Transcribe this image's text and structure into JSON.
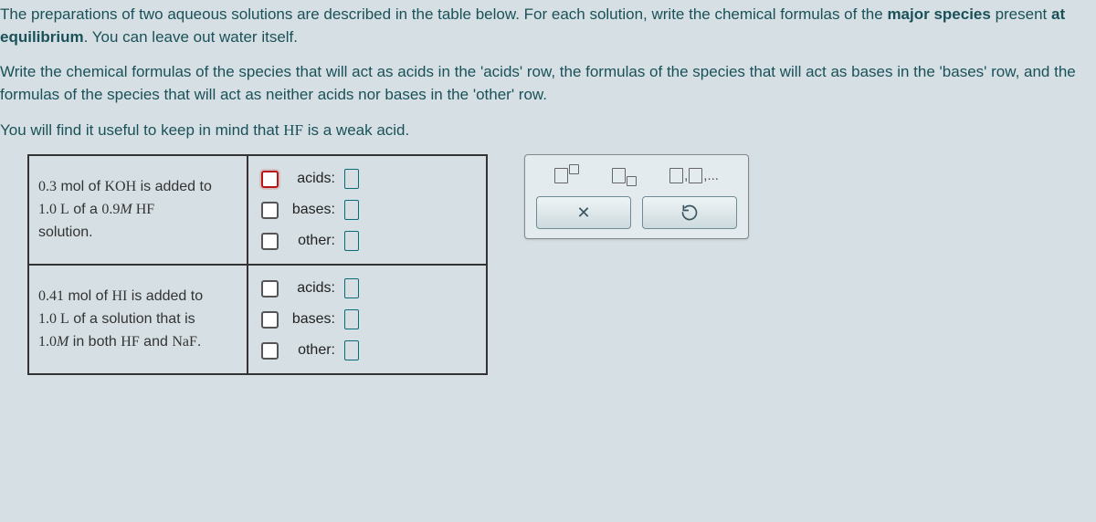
{
  "instructions": {
    "p1_a": "The preparations of two aqueous solutions are described in the table below. For each solution, write the chemical formulas of the ",
    "p1_b": "major species",
    "p1_c": " present ",
    "p1_d": "at equilibrium",
    "p1_e": ". You can leave out water itself.",
    "p2": "Write the chemical formulas of the species that will act as acids in the 'acids' row, the formulas of the species that will act as bases in the 'bases' row, and the formulas of the species that will act as neither acids nor bases in the 'other' row.",
    "p3_a": "You will find it useful to keep in mind that ",
    "p3_b": "HF",
    "p3_c": " is a weak acid."
  },
  "rows": {
    "acids": "acids:",
    "bases": "bases:",
    "other": "other:"
  },
  "solution1": {
    "d1a": "0.3",
    "d1b": " mol of ",
    "d1c": "KOH",
    "d1d": " is added to ",
    "d2a": "1.0 L",
    "d2b": " of a ",
    "d2c": "0.9",
    "d2d": "M",
    "d2e": " HF",
    "d3": "solution."
  },
  "solution2": {
    "d1a": "0.41",
    "d1b": " mol of ",
    "d1c": "HI",
    "d1d": " is added to",
    "d2a": "1.0 L",
    "d2b": " of a solution that is",
    "d3a": "1.0",
    "d3b": "M",
    "d3c": " in both ",
    "d3d": "HF",
    "d3e": " and ",
    "d3f": "NaF",
    "d3g": "."
  },
  "toolbox": {
    "list_hint": ",...",
    "clear": "×",
    "reset": "↺"
  }
}
